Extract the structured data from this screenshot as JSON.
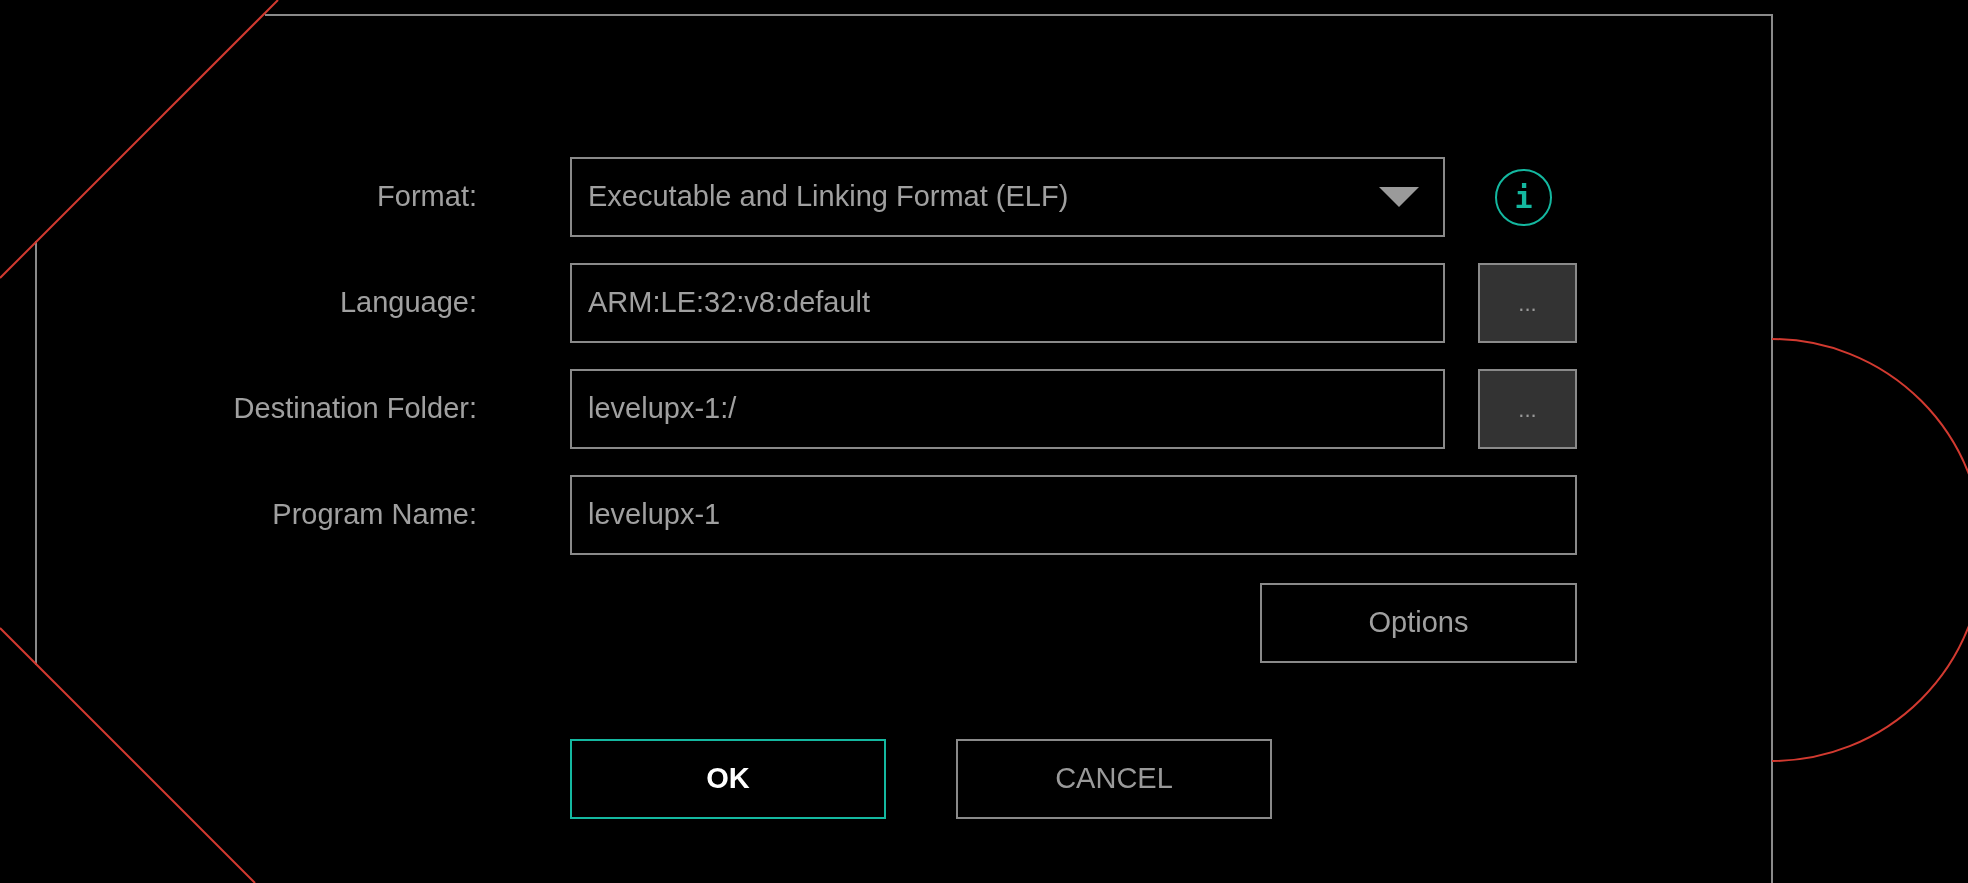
{
  "fields": [
    {
      "label": "Format:",
      "value": "Executable and Linking Format (ELF)",
      "kind": "dropdown",
      "info": "i"
    },
    {
      "label": "Language:",
      "value": "ARM:LE:32:v8:default",
      "kind": "browse",
      "browse": "..."
    },
    {
      "label": "Destination Folder:",
      "value": "levelupx-1:/",
      "kind": "browse",
      "browse": "..."
    },
    {
      "label": "Program Name:",
      "value": "levelupx-1",
      "kind": "text"
    }
  ],
  "options_button": "Options",
  "buttons": [
    {
      "label": "OK",
      "selected": true
    },
    {
      "label": "CANCEL",
      "selected": false
    }
  ]
}
